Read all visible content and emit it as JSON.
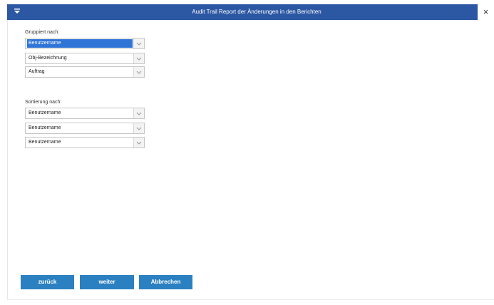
{
  "window": {
    "title": "Audit Trail Report der Änderungen in den Berichten",
    "menu_icon": "chevron-down-icon",
    "close_symbol": "×"
  },
  "grouping": {
    "label": "Gruppiert nach:",
    "selects": [
      {
        "value": "Benutzername",
        "selected": true
      },
      {
        "value": "Obj-Bezeichnung",
        "selected": false
      },
      {
        "value": "Auftrag",
        "selected": false
      }
    ]
  },
  "sorting": {
    "label": "Sortierung nach:",
    "selects": [
      {
        "value": "Benutzername",
        "selected": false
      },
      {
        "value": "Benutzername",
        "selected": false
      },
      {
        "value": "Benutzername",
        "selected": false
      }
    ]
  },
  "buttons": {
    "back": "zurück",
    "next": "weiter",
    "cancel": "Abbrechen"
  },
  "colors": {
    "titlebar": "#2c57a3",
    "button": "#2a80c0",
    "selection": "#2f75d6"
  }
}
